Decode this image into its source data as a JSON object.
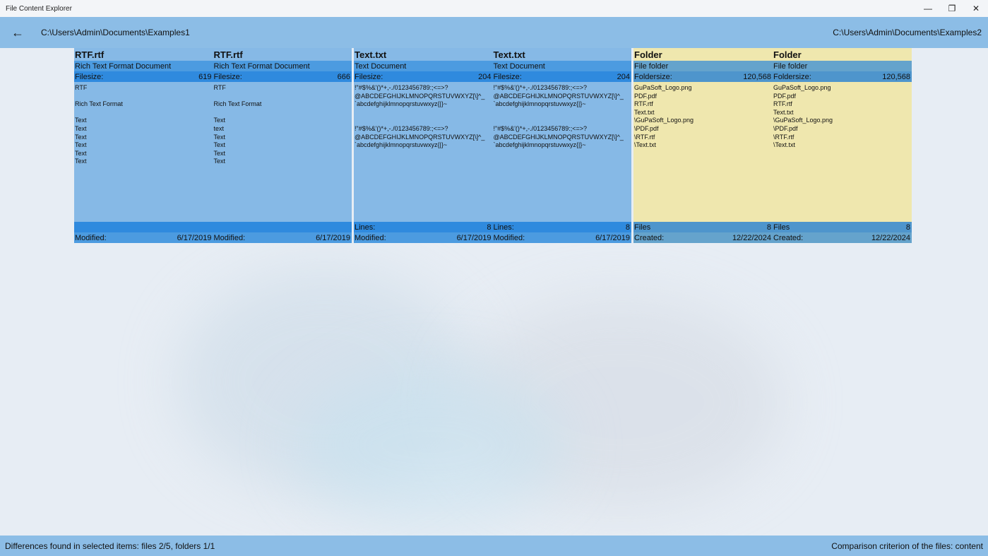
{
  "window": {
    "title": "File Content Explorer",
    "minimize": "—",
    "restore": "❐",
    "close": "✕"
  },
  "header": {
    "back": "←",
    "left_path": "C:\\Users\\Admin\\Documents\\Examples1",
    "right_path": "C:\\Users\\Admin\\Documents\\Examples2"
  },
  "panels": [
    {
      "left": {
        "name": "RTF.rtf",
        "type": "Rich Text Format Document",
        "size_label": "Filesize:",
        "size": "619",
        "content": "RTF\n\nRich Text Format\n\nText\nText\nText\nText\nText\nText",
        "lines_label": "",
        "lines": "",
        "date_label": "Modified:",
        "date": "6/17/2019"
      },
      "right": {
        "name": "RTF.rtf",
        "type": "Rich Text Format Document",
        "size_label": "Filesize:",
        "size": "666",
        "content": "RTF\n\nRich Text Format\n\nText\ntext\nText\nText\nText\nText",
        "lines_label": "",
        "lines": "",
        "date_label": "Modified:",
        "date": "6/17/2019"
      }
    },
    {
      "left": {
        "name": "Text.txt",
        "type": "Text Document",
        "size_label": "Filesize:",
        "size": "204",
        "content": "!\"#$%&'()*+,-./0123456789:;<=>?\n@ABCDEFGHIJKLMNOPQRSTUVWXYZ[\\]^_\n`abcdefghijklmnopqrstuvwxyz{|}~\n\n\n!\"#$%&'()*+,-./0123456789:;<=>?\n@ABCDEFGHIJKLMNOPQRSTUVWXYZ[\\]^_\n`abcdefghijklmnopqrstuvwxyz{|}~",
        "lines_label": "Lines:",
        "lines": "8",
        "date_label": "Modified:",
        "date": "6/17/2019"
      },
      "right": {
        "name": "Text.txt",
        "type": "Text Document",
        "size_label": "Filesize:",
        "size": "204",
        "content": "!\"#$%&'()*+,-./0123456789:;<=>?\n@ABCDEFGHIJKLMNOPQRSTUVWXYZ[\\]^_\n`abcdefghijklmnopqrstuvwxyz{|}~\n\n\n!\"#$%&'()*+,-./0123456789:;<=>?\n@ABCDEFGHIJKLMNOPQRSTUVWXYZ[\\]^_\n`abcdefghijklmnopqrstuvwxyz{|}~",
        "lines_label": "Lines:",
        "lines": "8",
        "date_label": "Modified:",
        "date": "6/17/2019"
      }
    },
    {
      "left": {
        "name": "Folder",
        "type": "File folder",
        "size_label": "Foldersize:",
        "size": "120,568",
        "content": "GuPaSoft_Logo.png\nPDF.pdf\nRTF.rtf\nText.txt\n\\GuPaSoft_Logo.png\n\\PDF.pdf\n\\RTF.rtf\n\\Text.txt",
        "lines_label": "Files",
        "lines": "8",
        "date_label": "Created:",
        "date": "12/22/2024"
      },
      "right": {
        "name": "Folder",
        "type": "File folder",
        "size_label": "Foldersize:",
        "size": "120,568",
        "content": "GuPaSoft_Logo.png\nPDF.pdf\nRTF.rtf\nText.txt\n\\GuPaSoft_Logo.png\n\\PDF.pdf\n\\RTF.rtf\n\\Text.txt",
        "lines_label": "Files",
        "lines": "8",
        "date_label": "Created:",
        "date": "12/22/2024"
      }
    }
  ],
  "status": {
    "left": "Differences found in selected items: files 2/5, folders 1/1",
    "right": "Comparison criterion of the files: content"
  }
}
